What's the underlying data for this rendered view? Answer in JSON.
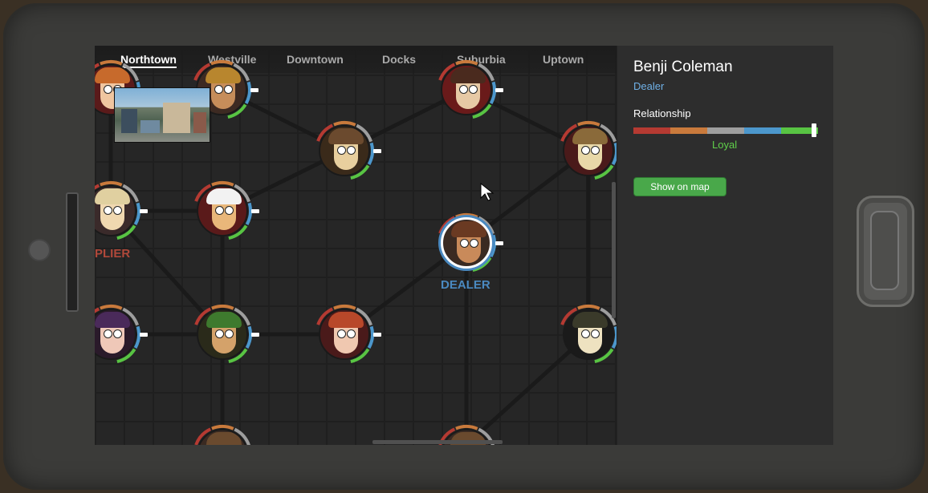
{
  "tabs": [
    {
      "label": "Northtown",
      "active": true
    },
    {
      "label": "Westville",
      "active": false
    },
    {
      "label": "Downtown",
      "active": false
    },
    {
      "label": "Docks",
      "active": false
    },
    {
      "label": "Suburbia",
      "active": false
    },
    {
      "label": "Uptown",
      "active": false
    }
  ],
  "graph": {
    "selected_label": "DEALER",
    "partial_label": "PLIER",
    "colors": {
      "dealer_label": "#4a89c0",
      "supplier_label": "#b0483a",
      "link": "#1a1a1a"
    }
  },
  "panel": {
    "name": "Benji Coleman",
    "role": "Dealer",
    "relationship_title": "Relationship",
    "relationship_value": "Loyal",
    "relationship_level": 0.98,
    "bar_colors": [
      "#b53a32",
      "#c97a3c",
      "#9e9e9e",
      "#4c97cc",
      "#58c443"
    ],
    "map_button": "Show on map"
  },
  "icons": {
    "cursor": "arrow-cursor-icon"
  }
}
